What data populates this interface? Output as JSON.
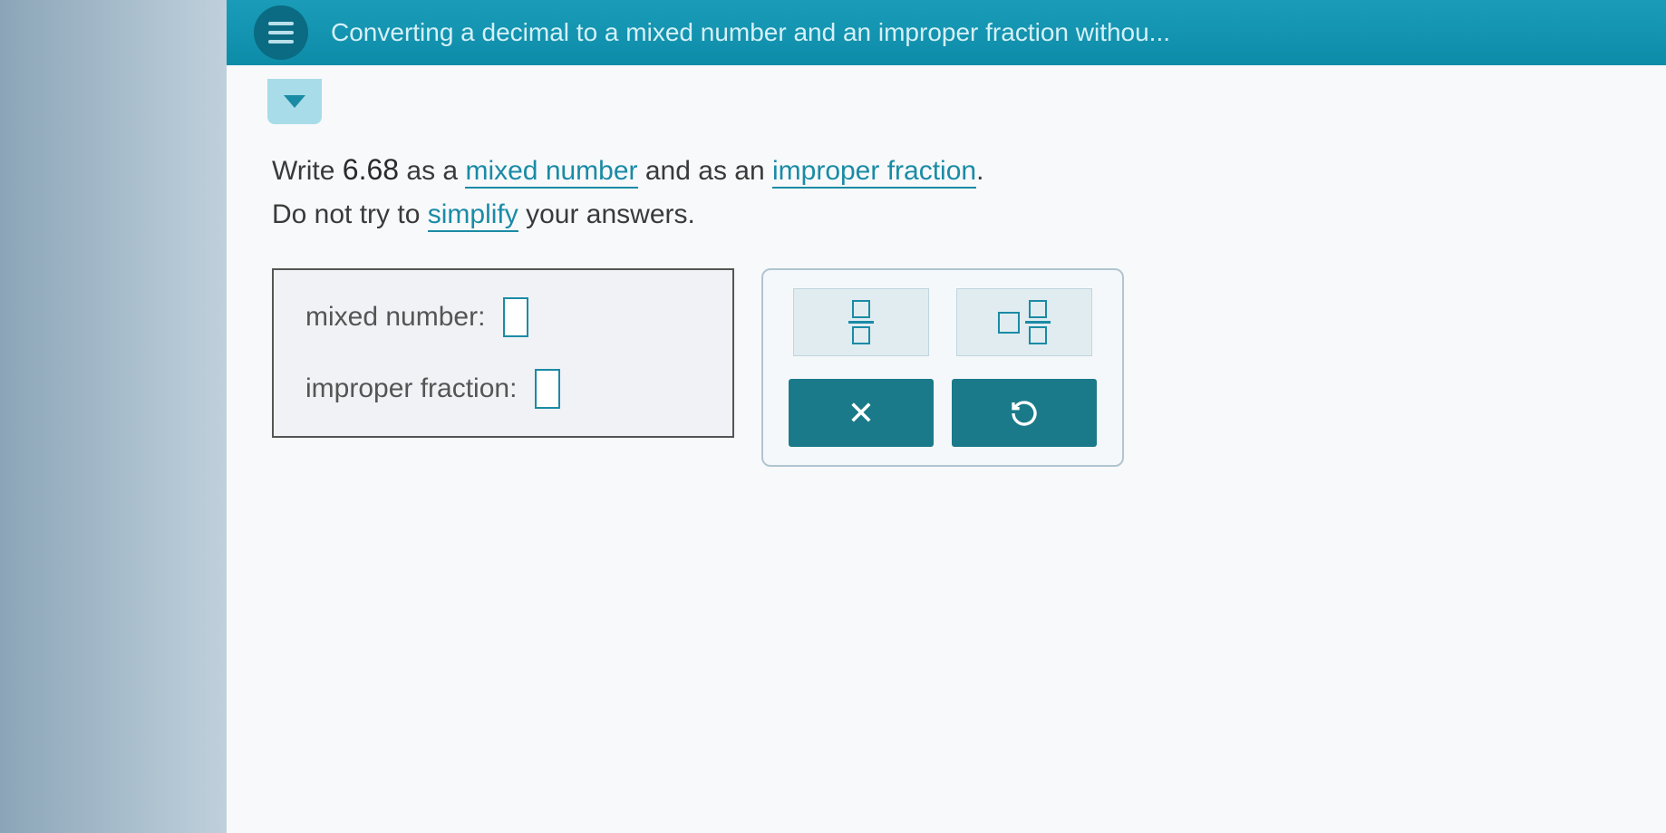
{
  "header": {
    "title": "Converting a decimal to a mixed number and an improper fraction withou..."
  },
  "question": {
    "prefix": "Write ",
    "number": "6.68",
    "mid1": " as a ",
    "term1": "mixed number",
    "mid2": " and as an ",
    "term2": "improper fraction",
    "suffix": ".",
    "line2_prefix": "Do not try to ",
    "term3": "simplify",
    "line2_suffix": " your answers."
  },
  "answers": {
    "mixed_label": "mixed number:",
    "improper_label": "improper fraction:"
  },
  "tools": {
    "fraction": "fraction",
    "mixed": "mixed-number",
    "clear": "X",
    "reset": "reset"
  }
}
